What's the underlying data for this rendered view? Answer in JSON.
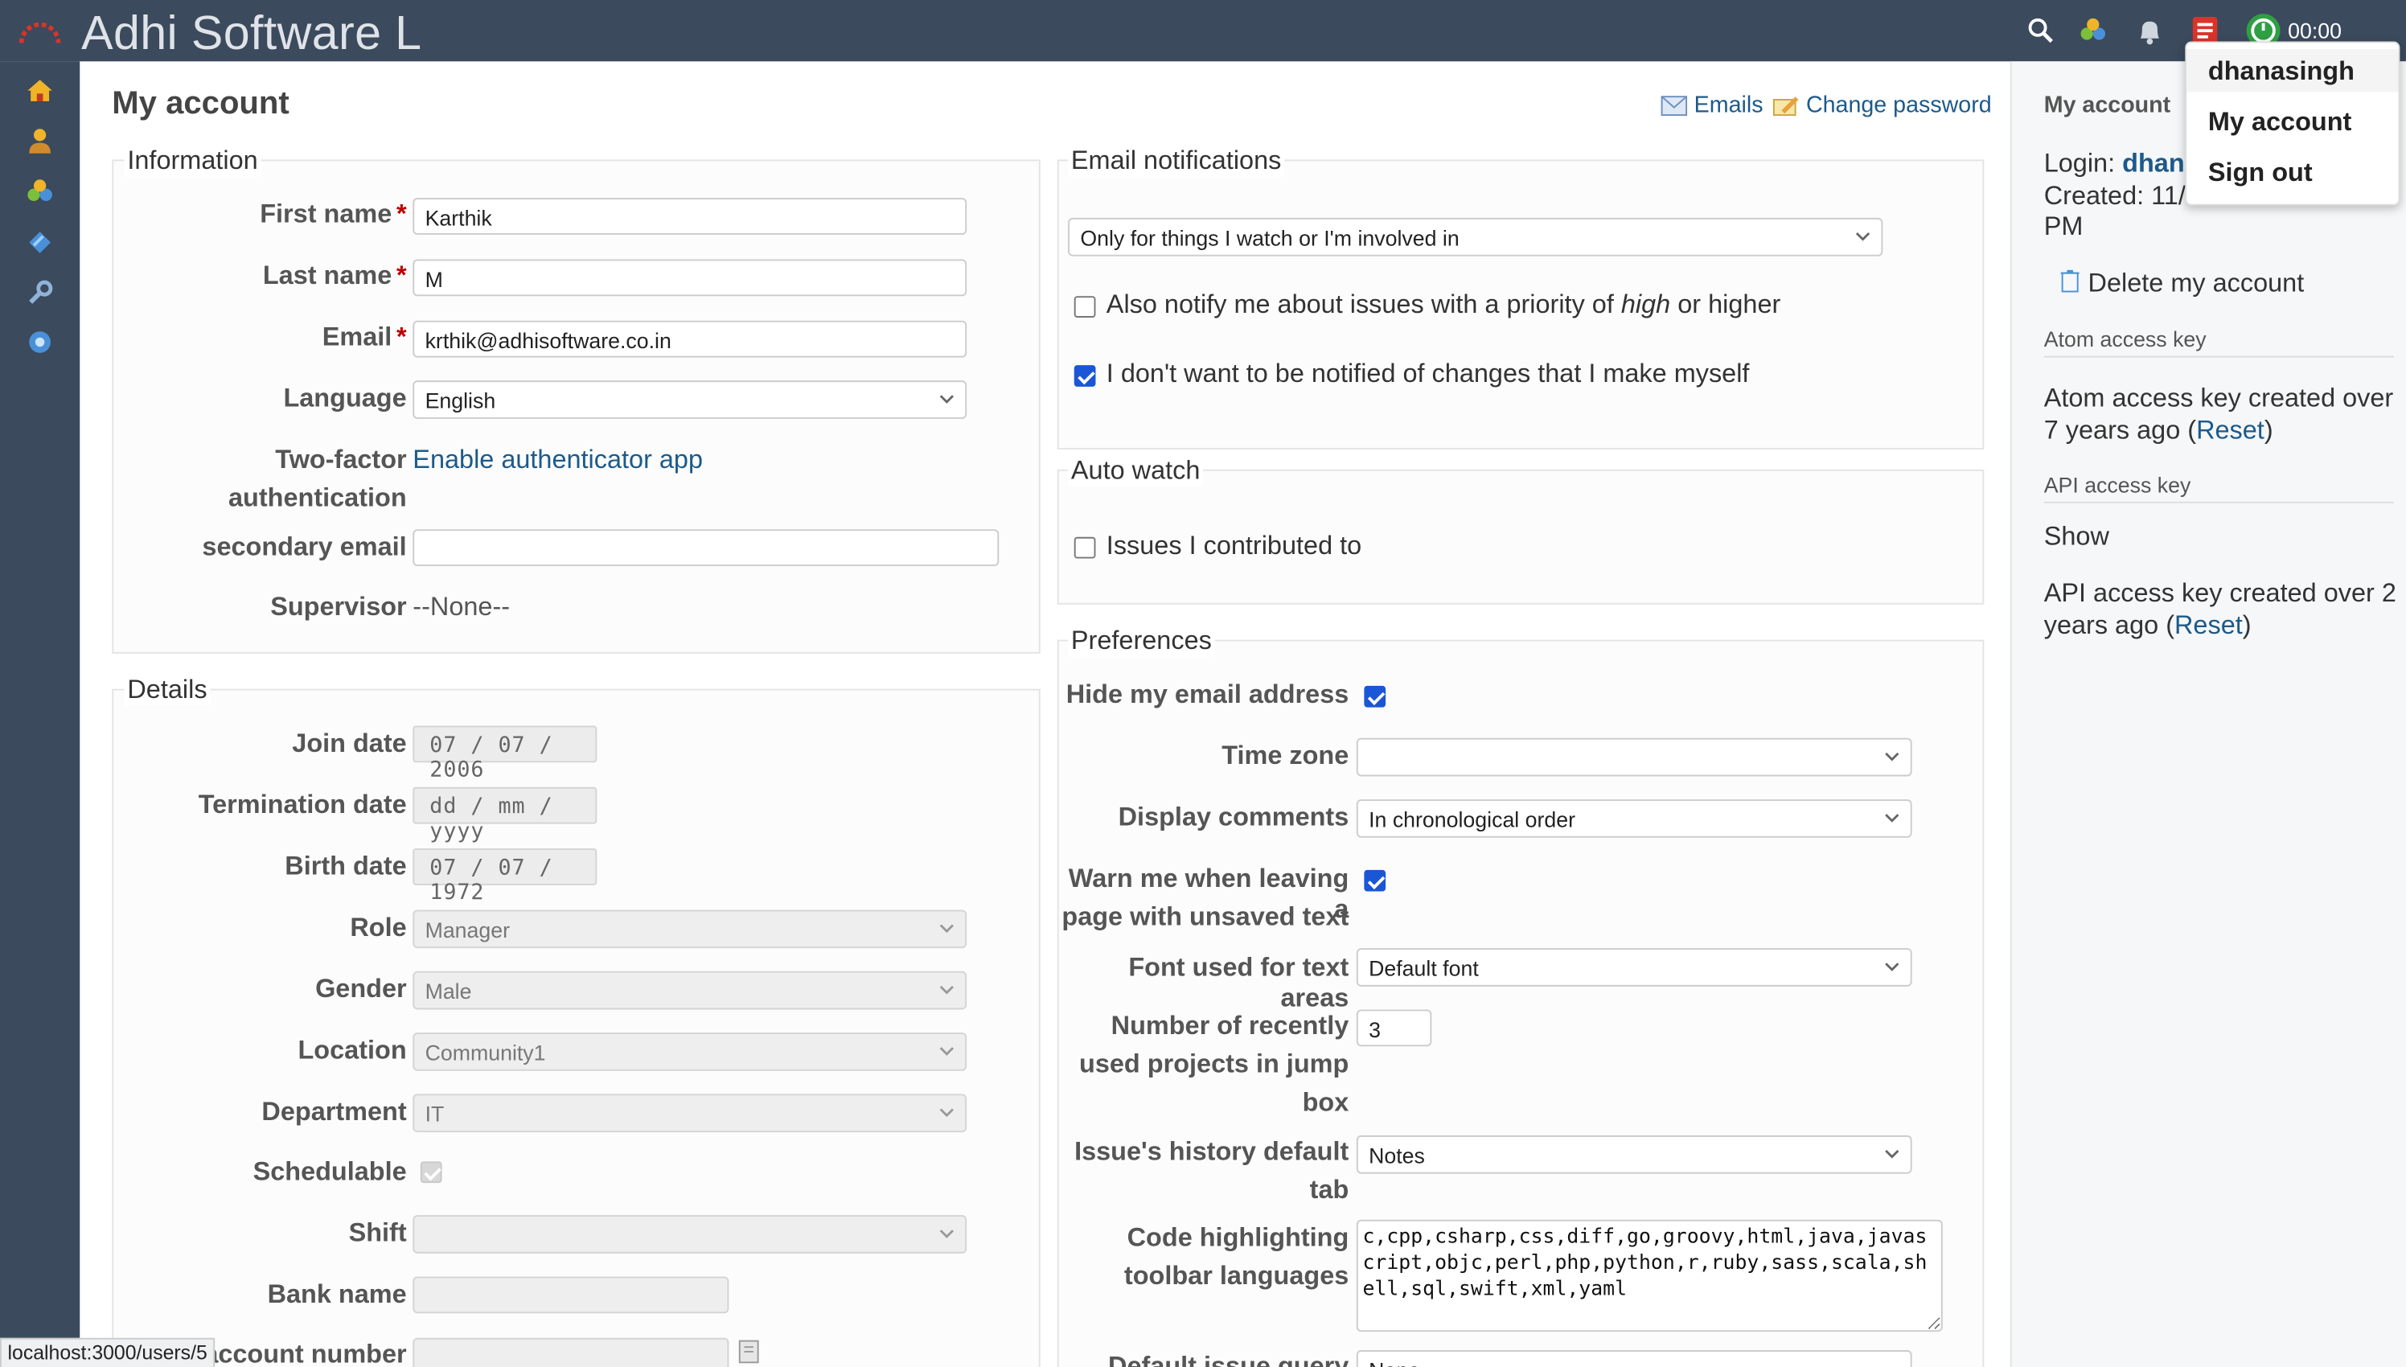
{
  "header": {
    "app_title": "Adhi Software L",
    "timer": "00:00",
    "icons": [
      "search-icon",
      "projects-icon",
      "bell-icon",
      "report-icon",
      "timer-icon"
    ]
  },
  "sidebar": {
    "items": [
      {
        "name": "home-icon"
      },
      {
        "name": "user-icon"
      },
      {
        "name": "projects-icon"
      },
      {
        "name": "tag-icon"
      },
      {
        "name": "wrench-icon"
      },
      {
        "name": "help-icon"
      }
    ]
  },
  "page": {
    "title": "My account",
    "emails_link": "Emails",
    "change_password_link": "Change password"
  },
  "information": {
    "legend": "Information",
    "first_name_label": "First name",
    "first_name": "Karthik",
    "last_name_label": "Last name",
    "last_name": "M",
    "email_label": "Email",
    "email": "krthik@adhisoftware.co.in",
    "required_mark": "*",
    "language_label": "Language",
    "language": "English",
    "two_factor_label_1": "Two-factor",
    "two_factor_label_2": "authentication",
    "two_factor_link": "Enable authenticator app",
    "secondary_email_label": "secondary email",
    "secondary_email": "",
    "supervisor_label": "Supervisor",
    "supervisor": "--None--"
  },
  "details": {
    "legend": "Details",
    "join_date_label": "Join date",
    "join_date": "07 / 07 / 2006",
    "termination_date_label": "Termination date",
    "termination_date": "dd / mm / yyyy",
    "birth_date_label": "Birth date",
    "birth_date": "07 / 07 / 1972",
    "role_label": "Role",
    "role": "Manager",
    "gender_label": "Gender",
    "gender": "Male",
    "location_label": "Location",
    "location": "Community1",
    "department_label": "Department",
    "department": "IT",
    "schedulable_label": "Schedulable",
    "schedulable": true,
    "shift_label": "Shift",
    "shift": "",
    "bank_name_label": "Bank name",
    "bank_name": "",
    "bank_account_label": "account number",
    "bank_account": ""
  },
  "email_notifications": {
    "legend": "Email notifications",
    "mode": "Only for things I watch or I'm involved in",
    "high_priority_text_1": "Also notify me about issues with a priority of",
    "high_priority_em": "high",
    "high_priority_text_2": "or higher",
    "high_priority_checked": false,
    "no_self_notified_text": "I don't want to be notified of changes that I make myself",
    "no_self_notified_checked": true
  },
  "auto_watch": {
    "legend": "Auto watch",
    "contributed_text": "Issues I contributed to",
    "contributed_checked": false
  },
  "preferences": {
    "legend": "Preferences",
    "hide_email_label": "Hide my email address",
    "hide_email_checked": true,
    "time_zone_label": "Time zone",
    "time_zone": "",
    "display_comments_label": "Display comments",
    "display_comments": "In chronological order",
    "warn_leaving_label_1": "Warn me when leaving a",
    "warn_leaving_label_2": "page with unsaved text",
    "warn_leaving_checked": true,
    "font_label": "Font used for text areas",
    "font": "Default font",
    "recent_projects_label_1": "Number of recently",
    "recent_projects_label_2": "used projects in jump",
    "recent_projects_label_3": "box",
    "recent_projects": "3",
    "history_tab_label_1": "Issue's history default",
    "history_tab_label_2": "tab",
    "history_tab": "Notes",
    "code_hl_label_1": "Code highlighting",
    "code_hl_label_2": "toolbar languages",
    "code_hl": "c,cpp,csharp,css,diff,go,groovy,html,java,javascript,objc,perl,php,python,r,ruby,sass,scala,shell,sql,swift,xml,yaml",
    "default_query_label": "Default issue query",
    "default_query": "None"
  },
  "right_sidebar": {
    "title": "My account",
    "login_label": "Login:",
    "login": "dhana",
    "created_1": "Created: 11/",
    "created_2": "PM",
    "delete_link": "Delete my account",
    "atom_heading": "Atom access key",
    "atom_text_1": "Atom access key created over",
    "atom_text_2": "7 years ago (",
    "reset": "Reset",
    "close_paren": ")",
    "api_heading": "API access key",
    "api_show": "Show",
    "api_text_1": "API access key created over 2",
    "api_text_2": "years ago ("
  },
  "user_menu": {
    "username": "dhanasingh",
    "my_account": "My account",
    "sign_out": "Sign out"
  },
  "status_bar": {
    "url": "localhost:3000/users/5"
  }
}
